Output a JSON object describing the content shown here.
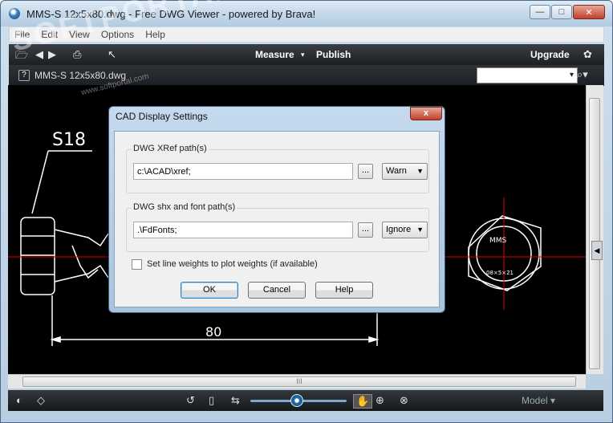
{
  "window": {
    "title": "MMS-S 12x5x80.dwg - Free DWG Viewer - powered by Brava!",
    "minimize": "—",
    "maximize": "□",
    "close": "✕"
  },
  "menu": [
    "File",
    "Edit",
    "View",
    "Options",
    "Help"
  ],
  "toolbar": {
    "measure": "Measure",
    "measure_arrow": "▾",
    "publish": "Publish",
    "upgrade": "Upgrade"
  },
  "strip": {
    "help": "?",
    "doc_tab": "MMS-S 12x5x80.dwg",
    "search_value": "",
    "search_arrow": "▾",
    "search_icon": "⌕▾"
  },
  "drawing": {
    "label_s18": "S18",
    "label_80": "80",
    "nut_text_top": "MMS",
    "nut_text_bottom": "08×5×21"
  },
  "dialog": {
    "title": "CAD Display Settings",
    "close": "x",
    "xref_group": "DWG XRef path(s)",
    "xref_value": "c:\\ACAD\\xref;",
    "xref_combo": "Warn",
    "shx_group": "DWG shx and font path(s)",
    "shx_value": ".\\FdFonts;",
    "shx_combo": "Ignore",
    "browse": "...",
    "checkbox_label": "Set line weights to plot weights (if available)",
    "ok": "OK",
    "cancel": "Cancel",
    "help": "Help"
  },
  "scroll": {
    "hthumb": "III"
  },
  "bottom": {
    "model": "Model",
    "model_arrow": "▾"
  },
  "watermark": {
    "logo": "SOFTPORTAL",
    "site": "www.softportal.com"
  },
  "colors": {
    "canvas": "#000000",
    "centerline": "#e00000",
    "linework": "#ffffff",
    "toolbar": "#1c1f23"
  }
}
